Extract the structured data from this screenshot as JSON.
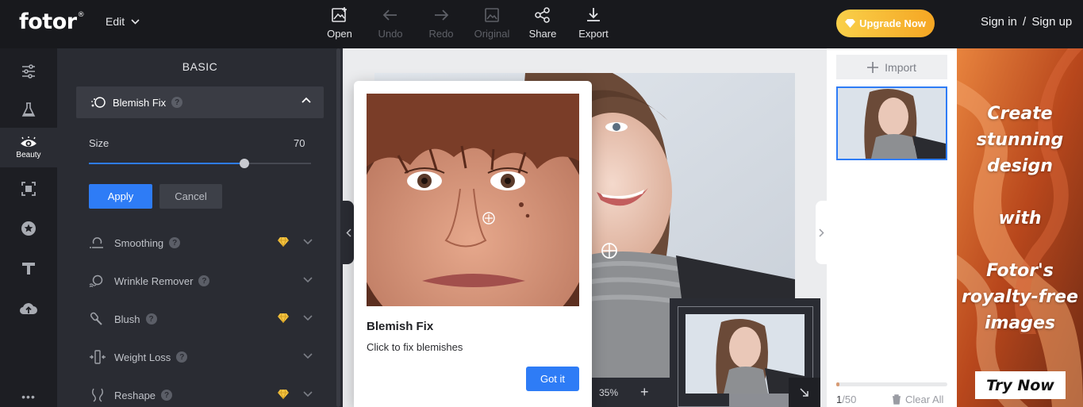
{
  "app": {
    "logo": "fotor",
    "logo_mark": "®"
  },
  "header": {
    "edit_menu": "Edit",
    "tools": [
      {
        "label": "Open",
        "icon": "image-add-icon",
        "enabled": true
      },
      {
        "label": "Undo",
        "icon": "arrow-left-icon",
        "enabled": false
      },
      {
        "label": "Redo",
        "icon": "arrow-right-icon",
        "enabled": false
      },
      {
        "label": "Original",
        "icon": "image-icon",
        "enabled": false
      },
      {
        "label": "Share",
        "icon": "share-icon",
        "enabled": true
      },
      {
        "label": "Export",
        "icon": "download-icon",
        "enabled": true
      }
    ],
    "upgrade": "Upgrade Now",
    "sign_in": "Sign in",
    "separator": "/",
    "sign_up": "Sign up"
  },
  "rail": {
    "items": [
      {
        "icon": "sliders-icon"
      },
      {
        "icon": "flask-icon"
      },
      {
        "icon": "eye-icon",
        "label": "Beauty",
        "active": true
      },
      {
        "icon": "frame-icon"
      },
      {
        "icon": "star-icon"
      },
      {
        "icon": "text-icon"
      },
      {
        "icon": "cloud-upload-icon"
      }
    ],
    "more": "•••"
  },
  "panel": {
    "title": "BASIC",
    "section": {
      "label": "Blemish Fix",
      "help": "?"
    },
    "size": {
      "label": "Size",
      "value": "70",
      "fraction": 0.7
    },
    "apply": "Apply",
    "cancel": "Cancel",
    "tools": [
      {
        "label": "Smoothing",
        "premium": true
      },
      {
        "label": "Wrinkle Remover",
        "premium": false
      },
      {
        "label": "Blush",
        "premium": true
      },
      {
        "label": "Weight Loss",
        "premium": false
      },
      {
        "label": "Reshape",
        "premium": true
      }
    ]
  },
  "canvas": {
    "zoom": "35%",
    "zoom_in": "+"
  },
  "tooltip": {
    "title": "Blemish Fix",
    "description": "Click to fix blemishes",
    "button": "Got it"
  },
  "right_panel": {
    "import": "Import",
    "progress_fraction": 0.02,
    "count_current": "1",
    "count_total": "/50",
    "clear_all": "Clear All"
  },
  "ad": {
    "lines": [
      "Create",
      "stunning",
      "design",
      "",
      "with",
      "",
      "Fotor's",
      "royalty-free",
      "images"
    ],
    "button": "Try Now"
  },
  "colors": {
    "accent": "#2e7cf6",
    "upgrade_start": "#f9d04a",
    "upgrade_end": "#f5a623",
    "premium_gem": "#f5c441"
  }
}
